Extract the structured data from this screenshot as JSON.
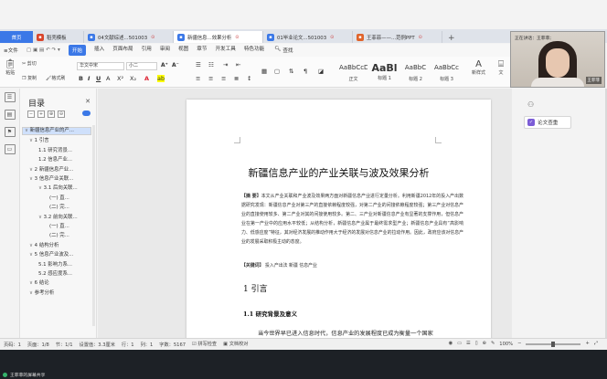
{
  "tabs": [
    {
      "label": "首页",
      "kind": "home"
    },
    {
      "label": "稻壳模板",
      "icon_color": "#d9452b"
    },
    {
      "label": "04文献综述...501003",
      "icon_color": "#3b78e7",
      "closable": true
    },
    {
      "label": "新疆信息...效果分析",
      "icon_color": "#3b78e7",
      "closable": true,
      "active": true
    },
    {
      "label": "01毕业论文...501003",
      "icon_color": "#3b78e7",
      "closable": true
    },
    {
      "label": "王菲菲——...范例PPT",
      "icon_color": "#e0642b",
      "closable": true
    }
  ],
  "tab_add": "+",
  "menu": {
    "file": "文件",
    "items": [
      "开始",
      "插入",
      "页面布局",
      "引用",
      "审阅",
      "视图",
      "章节",
      "开发工具",
      "特色功能"
    ],
    "search": "查找"
  },
  "ribbon": {
    "paste": "粘贴",
    "cut": "剪切",
    "copy": "复制",
    "format_painter": "格式刷",
    "font_name": "华文中宋",
    "font_size": "小二",
    "styles": [
      {
        "sample": "AaBbCcDd",
        "name": "正文"
      },
      {
        "sample": "AaBl",
        "name": "标题 1"
      },
      {
        "sample": "AaBbC",
        "name": "标题 2"
      },
      {
        "sample": "AaBbCc",
        "name": "标题 3"
      }
    ],
    "new_style": "新样式",
    "text_tools": "文"
  },
  "outline": {
    "title": "目录",
    "items": [
      {
        "text": "新疆信息产业的产...",
        "level": 0,
        "selected": true
      },
      {
        "text": "1 引言",
        "level": 1
      },
      {
        "text": "1.1 研究背景...",
        "level": 2
      },
      {
        "text": "1.2 信息产业...",
        "level": 2
      },
      {
        "text": "2 新疆信息产业...",
        "level": 1
      },
      {
        "text": "3 信息产业关联...",
        "level": 1
      },
      {
        "text": "3.1 后向关联...",
        "level": 2
      },
      {
        "text": "(一) 直...",
        "level": 3
      },
      {
        "text": "(二) 完...",
        "level": 3
      },
      {
        "text": "3.2 前向关联...",
        "level": 2
      },
      {
        "text": "(一) 直...",
        "level": 3
      },
      {
        "text": "(二) 完...",
        "level": 3
      },
      {
        "text": "4 结构分析",
        "level": 1
      },
      {
        "text": "5 信息产业波及...",
        "level": 1
      },
      {
        "text": "5.1 影响力系...",
        "level": 2
      },
      {
        "text": "5.2 感应度系...",
        "level": 2
      },
      {
        "text": "6 结论",
        "level": 1
      },
      {
        "text": "参考分析",
        "level": 1
      }
    ]
  },
  "document": {
    "title": "新疆信息产业的产业关联与波及效果分析",
    "abstract_label": "【摘  要】",
    "abstract_text": "本文从产业关联和产业波及效果两方面对新疆信息产业进行定量分析。利用新疆2012年的投入产出数据研究发现：新疆信息产业对第三产的直接依赖程度较强，对第二产业的间接依赖程度较强；第三产业对信息产业的直接使用较多、第二产业对其的间接使用较多。第二、三产业对新疆信息产业有显著的支撑作用，但信息产业在第一产业中的应用水平较低；从结构分析，新疆信息产业属于最终需求型产业；新疆信息产业具有“高影响力、低感应度”特征，其对经济发展的推动作用大于经济的发展对信息产业的拉动作用。因此，政府应该对信息产业的发展采取积极主动的态度。",
    "keywords_label": "【关键词】",
    "keywords_text": "投入产出法   新疆   信息产业",
    "heading1": "1 引言",
    "heading11": "1.1 研究背景及意义",
    "paragraph": "当今世界早已进入信息时代，信息产业的发展程度已成为衡量一个国家"
  },
  "right_panel": {
    "paper_check": "论文查重"
  },
  "webcam": {
    "label": "正在讲话：王菲菲;",
    "name": "王菲菲"
  },
  "status": {
    "page": "页码：1",
    "pages": "页面：1/8",
    "section": "节：1/1",
    "setting": "设置值：3.3厘米",
    "row": "行：1",
    "col": "列：1",
    "words": "字数：5167",
    "spell": "拼写检查",
    "doc_protect": "文档校对",
    "zoom": "100%"
  },
  "share": "王菲菲的屏幕共享",
  "colors": {
    "accent": "#3b78e7",
    "selection": "#cfe0fb"
  }
}
